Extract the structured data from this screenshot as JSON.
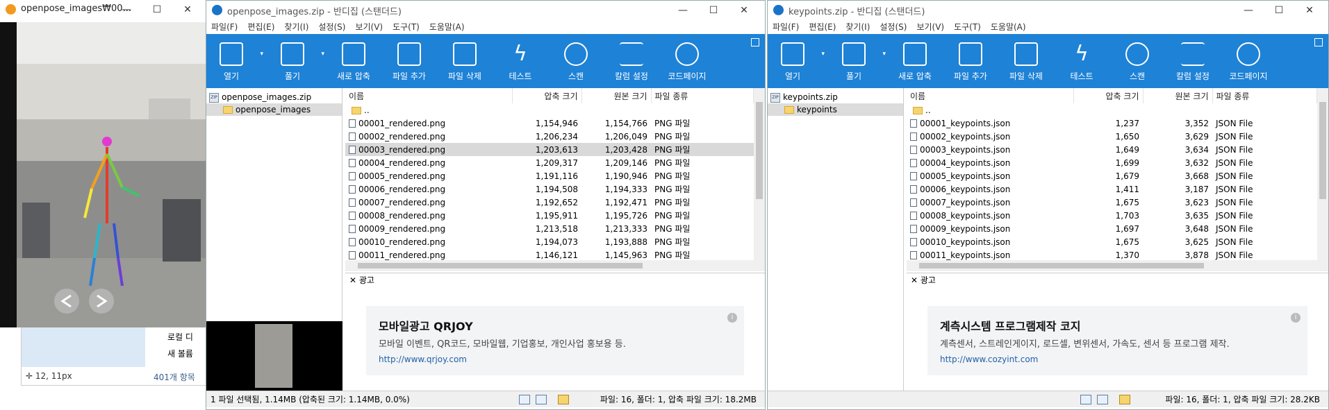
{
  "colors": {
    "toolbar": "#1e82d6",
    "selected_row": "#d9d9d9",
    "ad_bg": "#f3f4f6",
    "link": "#1f5fa8"
  },
  "viewer": {
    "title": "openpose_images₩00...",
    "status_coords": "12, 11px",
    "behind_items": [
      "로컬 디",
      "새 볼륨",
      "401개 항목"
    ]
  },
  "toolbar_labels": [
    "열기",
    "풀기",
    "새로 압축",
    "파일 추가",
    "파일 삭제",
    "테스트",
    "스캔",
    "칼럼 설정",
    "코드페이지"
  ],
  "menu": [
    "파일(F)",
    "편집(E)",
    "찾기(I)",
    "설정(S)",
    "보기(V)",
    "도구(T)",
    "도움말(A)"
  ],
  "win1": {
    "title": "openpose_images.zip - 반디집 (스탠더드)",
    "tree": [
      "openpose_images.zip",
      "openpose_images"
    ],
    "columns": [
      "이름",
      "압축 크기",
      "원본 크기",
      "파일 종류"
    ],
    "rows": [
      [
        "..",
        "",
        "",
        ""
      ],
      [
        "00001_rendered.png",
        "1,154,946",
        "1,154,766",
        "PNG 파일"
      ],
      [
        "00002_rendered.png",
        "1,206,234",
        "1,206,049",
        "PNG 파일"
      ],
      [
        "00003_rendered.png",
        "1,203,613",
        "1,203,428",
        "PNG 파일"
      ],
      [
        "00004_rendered.png",
        "1,209,317",
        "1,209,146",
        "PNG 파일"
      ],
      [
        "00005_rendered.png",
        "1,191,116",
        "1,190,946",
        "PNG 파일"
      ],
      [
        "00006_rendered.png",
        "1,194,508",
        "1,194,333",
        "PNG 파일"
      ],
      [
        "00007_rendered.png",
        "1,192,652",
        "1,192,471",
        "PNG 파일"
      ],
      [
        "00008_rendered.png",
        "1,195,911",
        "1,195,726",
        "PNG 파일"
      ],
      [
        "00009_rendered.png",
        "1,213,518",
        "1,213,333",
        "PNG 파일"
      ],
      [
        "00010_rendered.png",
        "1,194,073",
        "1,193,888",
        "PNG 파일"
      ],
      [
        "00011_rendered.png",
        "1,146,121",
        "1,145,963",
        "PNG 파일"
      ]
    ],
    "ad_label": "광고",
    "ad_title": "모바일광고 QRJOY",
    "ad_desc": "모바일 이벤트, QR코드, 모바일웹, 기업홍보, 개인사업 홍보용 등.",
    "ad_url": "http://www.qrjoy.com",
    "status_left": "1 파일 선택됨, 1.14MB (압축된 크기: 1.14MB, 0.0%)",
    "status_right": "파일: 16, 폴더: 1, 압축 파일 크기: 18.2MB"
  },
  "win2": {
    "title": "keypoints.zip - 반디집 (스탠더드)",
    "tree": [
      "keypoints.zip",
      "keypoints"
    ],
    "columns": [
      "이름",
      "압축 크기",
      "원본 크기",
      "파일 종류"
    ],
    "rows": [
      [
        "..",
        "",
        "",
        ""
      ],
      [
        "00001_keypoints.json",
        "1,237",
        "3,352",
        "JSON File"
      ],
      [
        "00002_keypoints.json",
        "1,650",
        "3,629",
        "JSON File"
      ],
      [
        "00003_keypoints.json",
        "1,649",
        "3,634",
        "JSON File"
      ],
      [
        "00004_keypoints.json",
        "1,699",
        "3,632",
        "JSON File"
      ],
      [
        "00005_keypoints.json",
        "1,679",
        "3,668",
        "JSON File"
      ],
      [
        "00006_keypoints.json",
        "1,411",
        "3,187",
        "JSON File"
      ],
      [
        "00007_keypoints.json",
        "1,675",
        "3,623",
        "JSON File"
      ],
      [
        "00008_keypoints.json",
        "1,703",
        "3,635",
        "JSON File"
      ],
      [
        "00009_keypoints.json",
        "1,697",
        "3,648",
        "JSON File"
      ],
      [
        "00010_keypoints.json",
        "1,675",
        "3,625",
        "JSON File"
      ],
      [
        "00011_keypoints.json",
        "1,370",
        "3,878",
        "JSON File"
      ]
    ],
    "ad_label": "광고",
    "ad_title": "계측시스템 프로그램제작 코지",
    "ad_desc": "계측센서, 스트레인게이지, 로드셀, 변위센서, 가속도, 센서 등 프로그램 제작.",
    "ad_url": "http://www.cozyint.com",
    "status_right": "파일: 16, 폴더: 1, 압축 파일 크기: 28.2KB"
  }
}
